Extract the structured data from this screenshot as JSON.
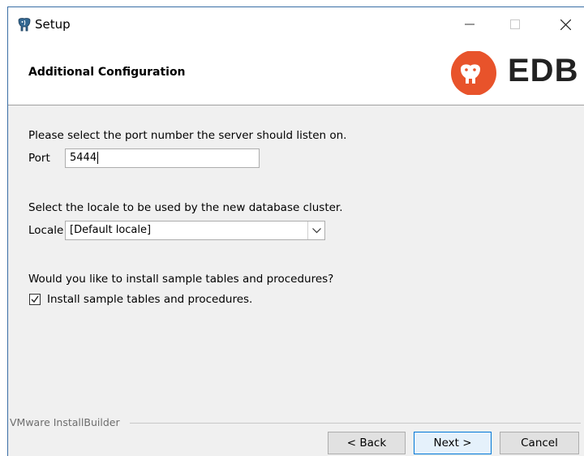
{
  "window": {
    "title": "Setup"
  },
  "header": {
    "title": "Additional Configuration",
    "brand": "EDB",
    "brand_color": "#e8532b"
  },
  "port_section": {
    "prompt": "Please select the port number the server should listen on.",
    "label": "Port",
    "value": "5444"
  },
  "locale_section": {
    "prompt": "Select the locale to be used by the new database cluster.",
    "label": "Locale",
    "selected": "[Default locale]"
  },
  "sample_section": {
    "prompt": "Would you like to install sample tables and procedures?",
    "checkbox_label": "Install sample tables and procedures.",
    "checked": true
  },
  "footer": {
    "vendor": "VMware InstallBuilder",
    "back_label": "< Back",
    "next_label": "Next >",
    "cancel_label": "Cancel"
  }
}
